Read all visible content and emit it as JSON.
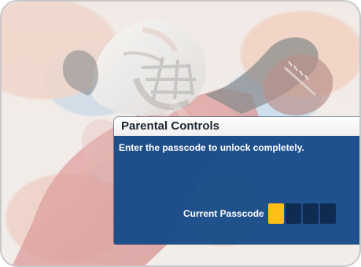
{
  "dialog": {
    "title": "Parental Controls",
    "message": "Enter the passcode to unlock completely."
  },
  "passcode": {
    "label": "Current Passcode",
    "digits_total": 4,
    "active_digit": 1
  },
  "colors": {
    "dialog_blue": "#164b88",
    "dialog_title_bg": "#ffffff",
    "active_digit": "#ffbf17",
    "inactive_digit": "#0f2b52"
  },
  "background": {
    "subject": "football-player-icon"
  }
}
